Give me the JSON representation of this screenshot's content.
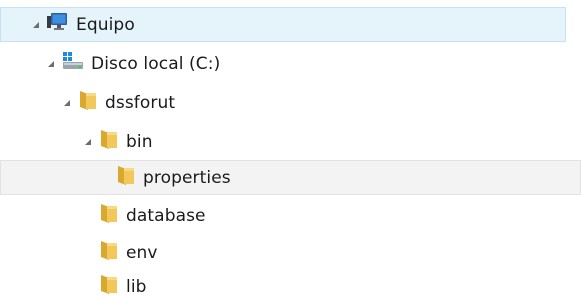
{
  "tree": {
    "nodes": [
      {
        "label": "Equipo",
        "icon": "computer-icon",
        "expanded": true,
        "selected": true
      },
      {
        "label": "Disco local (C:)",
        "icon": "local-disk-icon",
        "expanded": true
      },
      {
        "label": "dssforut",
        "icon": "folder-icon",
        "expanded": true
      },
      {
        "label": "bin",
        "icon": "folder-icon",
        "expanded": true
      },
      {
        "label": "properties",
        "icon": "folder-icon",
        "hovered": true
      },
      {
        "label": "database",
        "icon": "folder-icon"
      },
      {
        "label": "env",
        "icon": "folder-icon"
      },
      {
        "label": "lib",
        "icon": "folder-icon"
      }
    ]
  },
  "colors": {
    "selected_bg": "#e5f3fb",
    "selected_border": "#c5e3f5",
    "hover_bg": "#f3f3f3",
    "folder": "#f3c85a"
  }
}
